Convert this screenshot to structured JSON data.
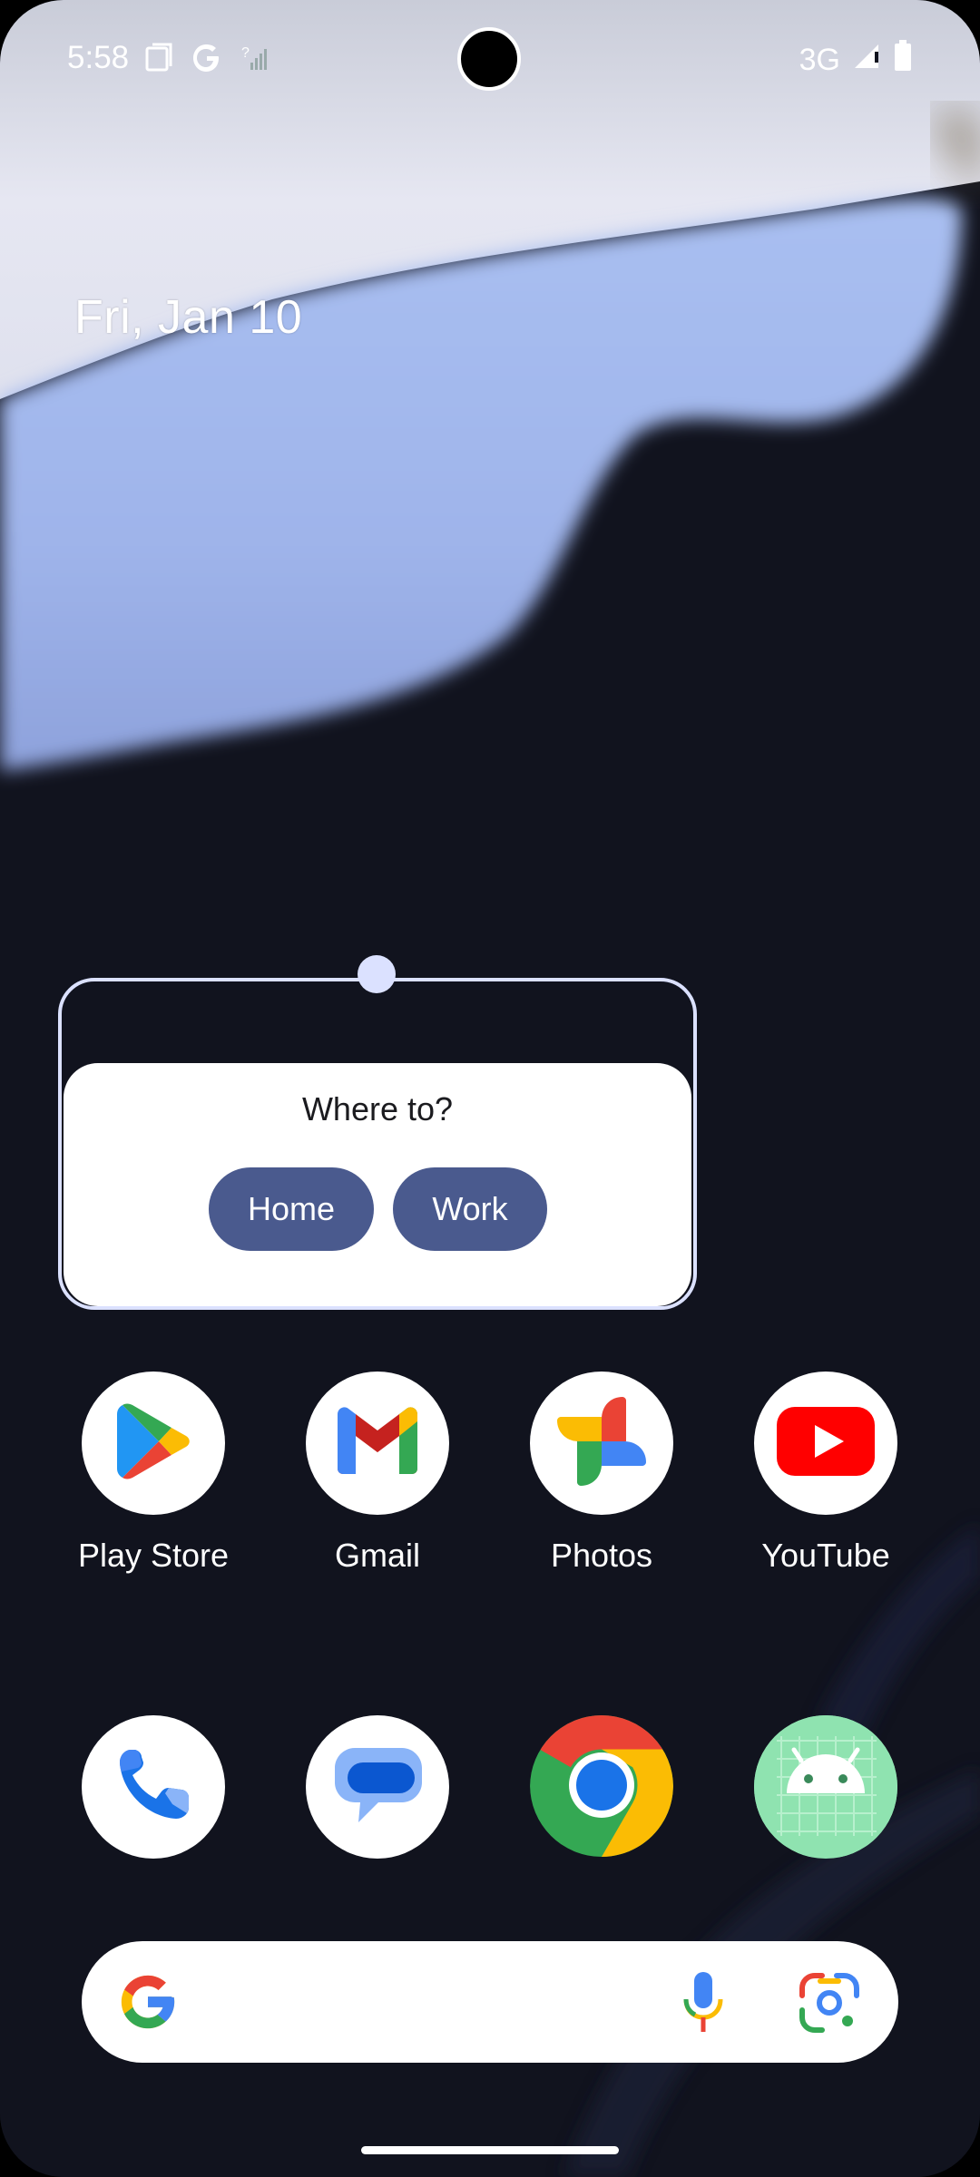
{
  "status_bar": {
    "time": "5:58",
    "network": "3G",
    "icons": [
      "screenshot-icon",
      "google-g-icon",
      "no-signal-icon",
      "signal-icon",
      "battery-icon"
    ]
  },
  "home": {
    "date": "Fri, Jan 10"
  },
  "widget": {
    "title": "Where to?",
    "buttons": [
      "Home",
      "Work"
    ],
    "accent": "#4a5a8e",
    "frame_color": "#dbe1ff"
  },
  "apps_row1": [
    {
      "label": "Play Store",
      "icon": "play-store-icon"
    },
    {
      "label": "Gmail",
      "icon": "gmail-icon"
    },
    {
      "label": "Photos",
      "icon": "photos-icon"
    },
    {
      "label": "YouTube",
      "icon": "youtube-icon"
    }
  ],
  "dock": [
    {
      "icon": "phone-icon"
    },
    {
      "icon": "messages-icon"
    },
    {
      "icon": "chrome-icon"
    },
    {
      "icon": "android-icon"
    }
  ],
  "search": {
    "icons": [
      "google-logo-icon",
      "microphone-icon",
      "lens-icon"
    ]
  }
}
